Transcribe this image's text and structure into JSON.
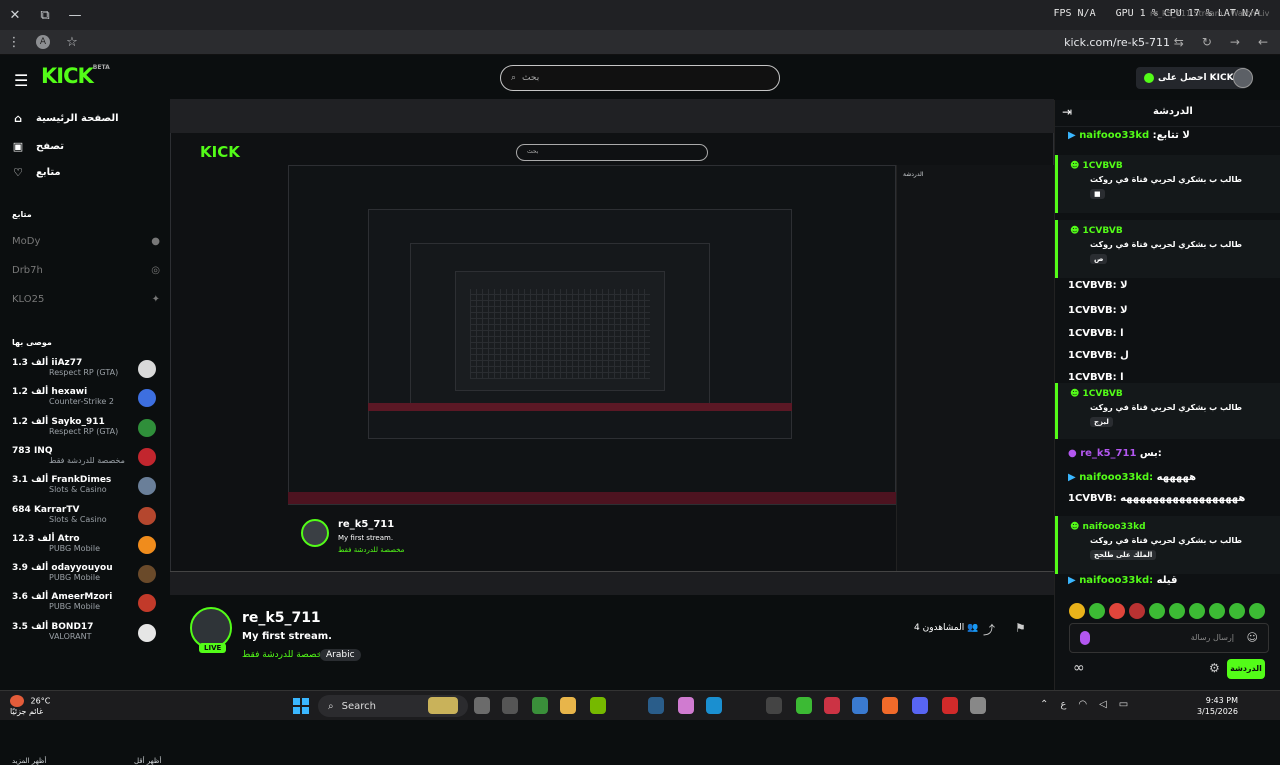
{
  "browser": {
    "tab_title": "re_k5_711 Stream - Watch Liv",
    "perf": {
      "fps_label": "FPS",
      "fps_value": "N/A",
      "gpu_label": "GPU",
      "gpu_value": "1 %",
      "cpu_label": "CPU",
      "cpu_value": "17 %",
      "lat_label": "LAT",
      "lat_value": "N/A"
    },
    "profile_letter": "A",
    "url": "kick.com/re-k5-711"
  },
  "header": {
    "logo": "KICK",
    "logo_badge": "BETA",
    "search_placeholder": "بحث",
    "get_kicks": "احصل على KICKs"
  },
  "sidebar": {
    "nav": [
      {
        "label": "الصفحة الرئيسية",
        "icon": "home-icon"
      },
      {
        "label": "تصفح",
        "icon": "browse-icon"
      },
      {
        "label": "متابع",
        "icon": "heart-icon"
      }
    ],
    "following_title": "متابع",
    "following": [
      {
        "name": "MoDy"
      },
      {
        "name": "Drb7h"
      },
      {
        "name": "KLO25"
      }
    ],
    "recommended_title": "موصى بها",
    "recommended": [
      {
        "viewers": "1.3 ألف",
        "name": "iiAz77",
        "category": "Respect RP (GTA)",
        "color": "#d9d9d9"
      },
      {
        "viewers": "1.2 ألف",
        "name": "hexawi",
        "category": "Counter-Strike 2",
        "color": "#3d6fe0"
      },
      {
        "viewers": "1.2 ألف",
        "name": "Sayko_911",
        "category": "Respect RP (GTA)",
        "color": "#2f8f3a"
      },
      {
        "viewers": "783",
        "name": "INQ",
        "category": "مخصصة للدردشة فقط",
        "color": "#c2262e"
      },
      {
        "viewers": "3.1 ألف",
        "name": "FrankDimes",
        "category": "Slots & Casino",
        "color": "#6a7f99"
      },
      {
        "viewers": "684",
        "name": "KarrarTV",
        "category": "Slots & Casino",
        "color": "#b5472e"
      },
      {
        "viewers": "12.3 ألف",
        "name": "Atro",
        "category": "PUBG Mobile",
        "color": "#f08c1c"
      },
      {
        "viewers": "3.9 ألف",
        "name": "odayyouyou",
        "category": "PUBG Mobile",
        "color": "#6a4a2a"
      },
      {
        "viewers": "3.6 ألف",
        "name": "AmeerMzori",
        "category": "PUBG Mobile",
        "color": "#c23a2a"
      },
      {
        "viewers": "3.5 ألف",
        "name": "BOND17",
        "category": "VALORANT",
        "color": "#e6e6e6"
      }
    ],
    "show_more": "أظهر المزيد",
    "show_less": "أظهر أقل"
  },
  "stream": {
    "mini_name": "re_k5_711",
    "mini_title": "My first stream.",
    "mini_tag": "مخصصة للدردشة فقط",
    "mini_search": "بحث"
  },
  "streamer": {
    "name": "re_k5_711",
    "title": "My first stream.",
    "category": "مخصصة للدردشة فقط",
    "language": "Arabic",
    "live": "LIVE",
    "viewers": "4 المشاهدون"
  },
  "chat": {
    "title": "الدردشة",
    "messages": [
      {
        "type": "plain",
        "user": "naifooo33kd",
        "text": ":لا تتابع"
      },
      {
        "type": "hl",
        "user": "1CVBVB",
        "text": "طالب ب بشكري لحربي قناة في روكت",
        "pill": "■"
      },
      {
        "type": "hl",
        "user": "1CVBVB",
        "text": "طالب ب بشكري لحربي قناة في روكت",
        "pill": "ص"
      },
      {
        "type": "line",
        "user": "1CVBVB:",
        "text": "لا"
      },
      {
        "type": "line",
        "user": "1CVBVB:",
        "text": "لا"
      },
      {
        "type": "line",
        "user": "1CVBVB:",
        "text": "ا"
      },
      {
        "type": "line",
        "user": "1CVBVB:",
        "text": "ل"
      },
      {
        "type": "line",
        "user": "1CVBVB:",
        "text": "ا"
      },
      {
        "type": "hl",
        "user": "1CVBVB",
        "text": "طالب ب بشكري لحربي قناة في روكت",
        "pill": "لبزج"
      },
      {
        "type": "line",
        "user": "re_k5_711",
        "text": "بس:"
      },
      {
        "type": "line",
        "user": "naifooo33kd:",
        "text": "هههههه"
      },
      {
        "type": "line",
        "user": "1CVBVB:",
        "text": "ههههههههههههههههههه"
      },
      {
        "type": "hl",
        "user": "naifooo33kd",
        "text": "طالب ب بشكري لحربي قناة في روكت",
        "pill": "الملك على طلحج"
      },
      {
        "type": "line",
        "user": "naifooo33kd:",
        "text": "قيله"
      }
    ],
    "input_placeholder": "إرسال رسالة",
    "send": "الدردشة"
  },
  "taskbar": {
    "temp": "26°C",
    "weather": "غائم جزئيًا",
    "search": "Search",
    "lang": "ع",
    "time": "9:43 PM",
    "date": "3/15/2026"
  }
}
